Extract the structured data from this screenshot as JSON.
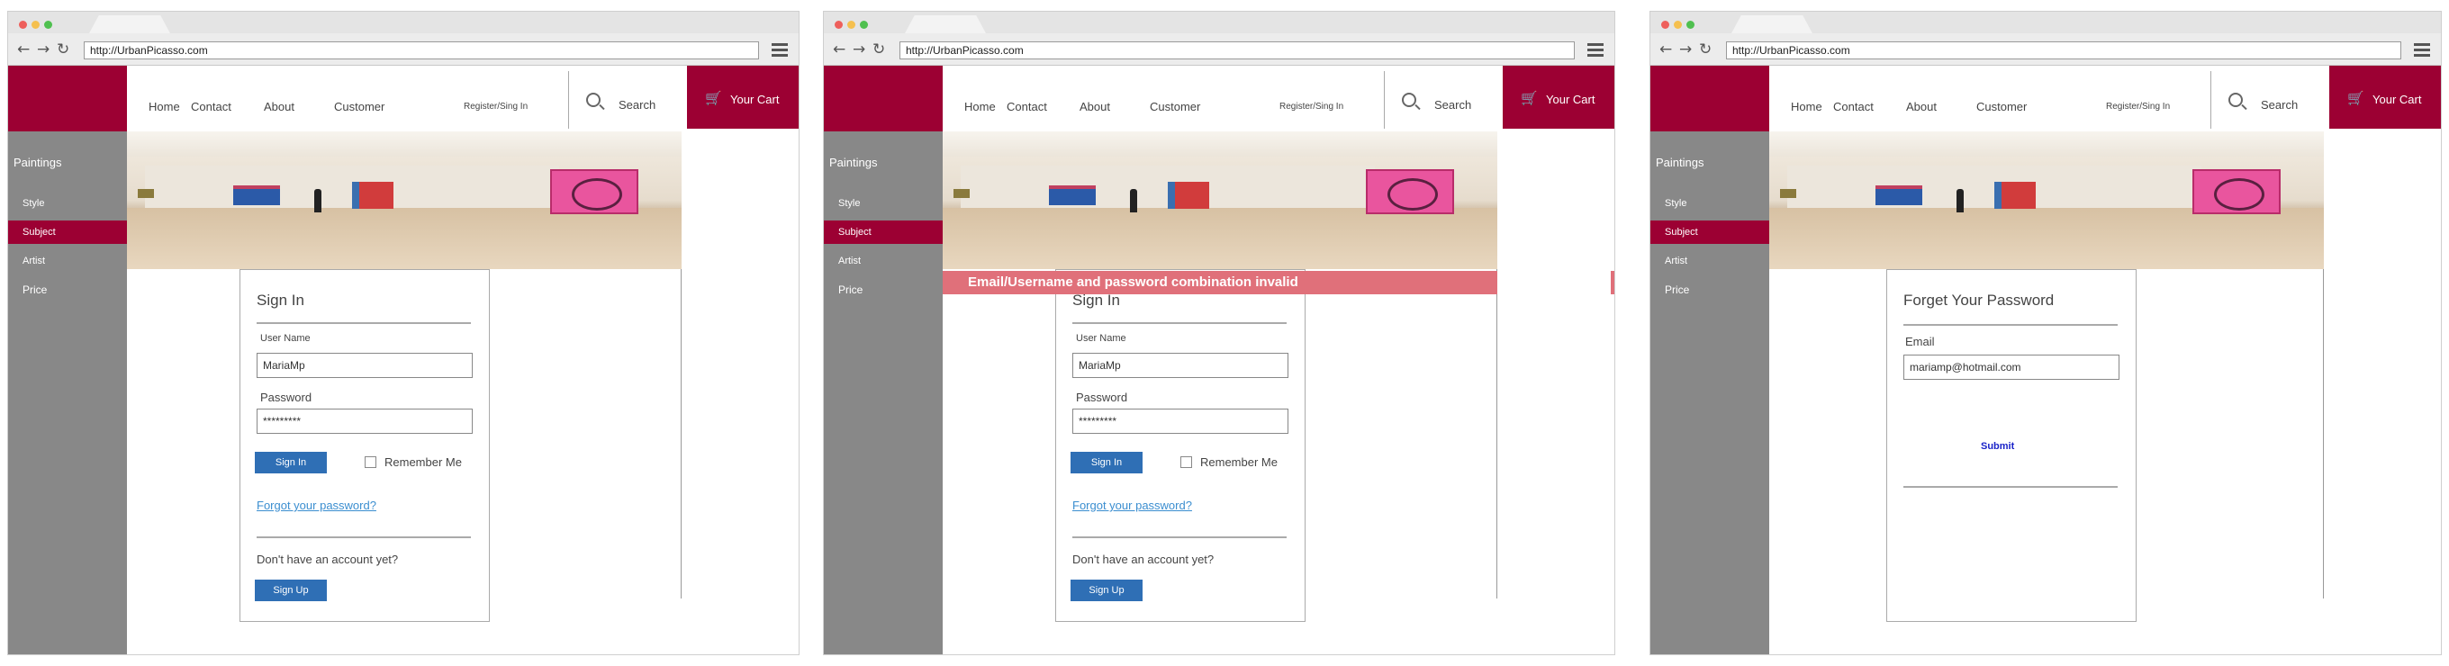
{
  "browser": {
    "url": "http://UrbanPicasso.com"
  },
  "nav": {
    "home": "Home",
    "contact": "Contact",
    "about": "About",
    "customer": "Customer",
    "register": "Register/Sing In",
    "search": "Search",
    "cart": "Your Cart"
  },
  "sidebar": {
    "title": "Paintings",
    "items": [
      {
        "label": "Style",
        "active": false
      },
      {
        "label": "Subject",
        "active": true
      },
      {
        "label": "Artist",
        "active": false
      },
      {
        "label": "Price",
        "active": false
      }
    ]
  },
  "icons": {
    "back": "arrow-left-icon",
    "forward": "arrow-right-icon",
    "reload": "reload-icon",
    "menu": "hamburger-icon",
    "search": "search-icon",
    "cart": "cart-icon"
  },
  "colors": {
    "brand": "#9c0033",
    "sidebar": "#888888",
    "button": "#2f6fb5",
    "error": "#e0707a",
    "link": "#3b8ed0"
  },
  "signin": {
    "title": "Sign In",
    "username_label": "User Name",
    "username_value": "MariaMp",
    "password_label": "Password",
    "password_value": "*********",
    "signin_button": "Sign In",
    "remember_me": "Remember Me",
    "forgot_link": "Forgot your password?",
    "no_account": "Don't have an account yet?",
    "signup_button": "Sign Up"
  },
  "error": {
    "message": "Email/Username and password combination invalid"
  },
  "forgot": {
    "title": "Forget Your Password",
    "email_label": "Email",
    "email_value": "mariamp@hotmail.com",
    "submit": "Submit"
  }
}
